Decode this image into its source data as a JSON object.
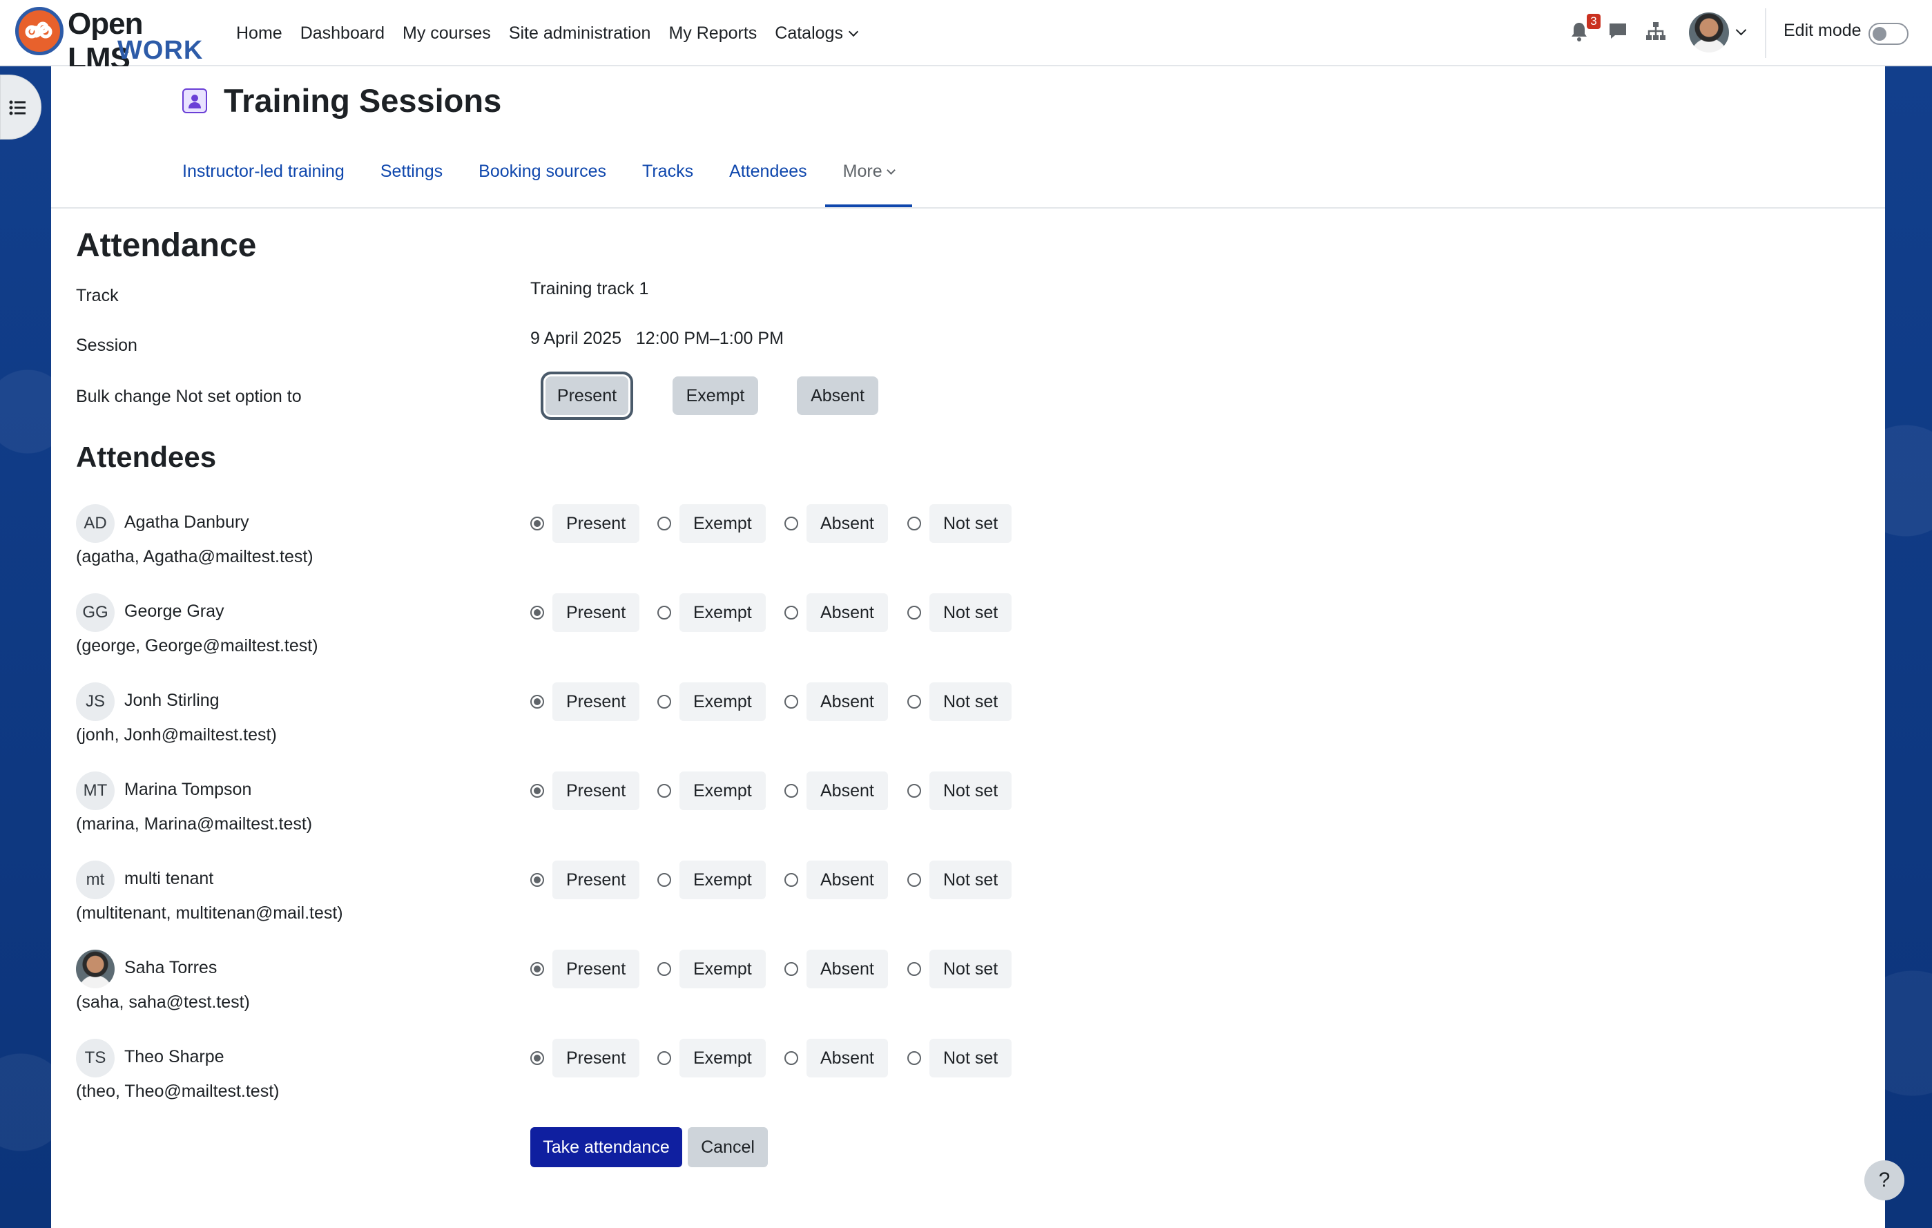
{
  "brand": {
    "name_line1": "Open LMS",
    "name_line2": "WORK"
  },
  "nav": {
    "items": [
      "Home",
      "Dashboard",
      "My courses",
      "Site administration",
      "My Reports",
      "Catalogs"
    ],
    "notifications_count": "3",
    "edit_mode_label": "Edit mode"
  },
  "page": {
    "title": "Training Sessions",
    "tabs": [
      "Instructor-led training",
      "Settings",
      "Booking sources",
      "Tracks",
      "Attendees",
      "More"
    ]
  },
  "attendance": {
    "heading": "Attendance",
    "track_label": "Track",
    "track_value": "Training track 1",
    "session_label": "Session",
    "session_value": "9 April 2025   12:00 PM–1:00 PM",
    "bulk_label": "Bulk change Not set option to",
    "bulk_buttons": [
      "Present",
      "Exempt",
      "Absent"
    ]
  },
  "attendees": {
    "heading": "Attendees",
    "options": [
      "Present",
      "Exempt",
      "Absent",
      "Not set"
    ],
    "list": [
      {
        "initials": "AD",
        "name": "Agatha Danbury",
        "email": "(agatha, Agatha@mailtest.test)",
        "selected": "Present"
      },
      {
        "initials": "GG",
        "name": "George Gray",
        "email": "(george, George@mailtest.test)",
        "selected": "Present"
      },
      {
        "initials": "JS",
        "name": "Jonh Stirling",
        "email": "(jonh, Jonh@mailtest.test)",
        "selected": "Present"
      },
      {
        "initials": "MT",
        "name": "Marina Tompson",
        "email": "(marina, Marina@mailtest.test)",
        "selected": "Present"
      },
      {
        "initials": "mt",
        "name": "multi tenant",
        "email": "(multitenant, multitenan@mail.test)",
        "selected": "Present"
      },
      {
        "initials": "",
        "name": "Saha Torres",
        "email": "(saha, saha@test.test)",
        "selected": "Present"
      },
      {
        "initials": "TS",
        "name": "Theo Sharpe",
        "email": "(theo, Theo@mailtest.test)",
        "selected": "Present"
      }
    ]
  },
  "actions": {
    "submit": "Take attendance",
    "cancel": "Cancel",
    "help": "?"
  }
}
